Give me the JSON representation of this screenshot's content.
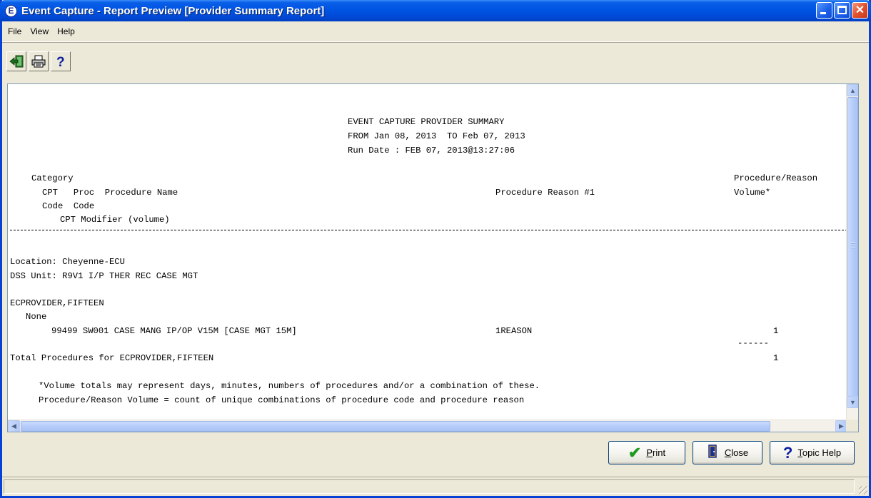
{
  "window": {
    "title": "Event Capture - Report Preview [Provider Summary Report]",
    "app_icon_letter": "E"
  },
  "menu": [
    {
      "label": "File"
    },
    {
      "label": "View"
    },
    {
      "label": "Help"
    }
  ],
  "toolbar": {
    "buttons": [
      {
        "icon": "exit-icon"
      },
      {
        "icon": "printer-icon"
      },
      {
        "icon": "help-icon"
      }
    ]
  },
  "report": {
    "title": "EVENT CAPTURE PROVIDER SUMMARY",
    "date_range": "FROM Jan 08, 2013  TO Feb 07, 2013",
    "run_date": "Run Date : FEB 07, 2013@13:27:06",
    "header": {
      "category": "Category",
      "cpt_proc": "CPT   Proc  Procedure Name",
      "reason_col": "Procedure Reason #1",
      "volume_col_1": "Procedure/Reason",
      "volume_col_2": "Volume*",
      "code_code": "Code  Code",
      "cpt_modifier": "CPT Modifier (volume)"
    },
    "location": "Location: Cheyenne-ECU",
    "dss_unit": "DSS Unit: R9V1 I/P THER REC CASE MGT",
    "provider": "ECPROVIDER,FIFTEEN",
    "category_value": "None",
    "procedure_line": "99499 SW001 CASE MANG IP/OP V15M [CASE MGT 15M]",
    "procedure_reason": "1REASON",
    "procedure_volume": "1",
    "volume_separator": "------",
    "total_label": "Total Procedures for ECPROVIDER,FIFTEEN",
    "total_value": "1",
    "footnote_1": "*Volume totals may represent days, minutes, numbers of procedures and/or a combination of these.",
    "footnote_2": "Procedure/Reason Volume = count of unique combinations of procedure code and procedure reason"
  },
  "buttons": {
    "print": "Print",
    "close": "Close",
    "topic_help": "Topic Help"
  },
  "colors": {
    "titlebar": "#0054e3",
    "window_bg": "#ece9d8",
    "scrollbar": "#b6cdfa",
    "print_check": "#1e9a1e",
    "close_icon": "#1c2f8f"
  }
}
